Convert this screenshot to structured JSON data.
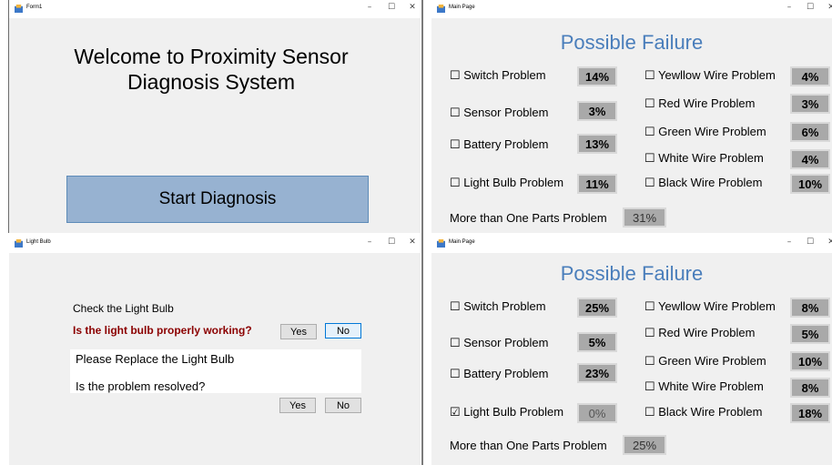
{
  "form1": {
    "title": "Form1",
    "welcome_line1": "Welcome to Proximity Sensor",
    "welcome_line2": "Diagnosis System",
    "start_button": "Start Diagnosis"
  },
  "lightbulb": {
    "title": "Light Bulb",
    "check_label": "Check the Light Bulb",
    "question": "Is the light bulb properly working?",
    "yes": "Yes",
    "no": "No",
    "replace_text": "Please Replace the Light Bulb",
    "resolved_text": "Is the problem resolved?",
    "yes2": "Yes",
    "no2": "No"
  },
  "window_controls": {
    "minimize": "–",
    "maximize": "☐",
    "close": "✕"
  },
  "main1": {
    "title": "Main Page",
    "heading": "Possible Failure",
    "items": [
      {
        "label": "☐ Switch Problem",
        "value": "14%"
      },
      {
        "label": "☐ Sensor Problem",
        "value": "3%"
      },
      {
        "label": "☐ Battery Problem",
        "value": "13%"
      },
      {
        "label": "☐ Light Bulb Problem",
        "value": "11%"
      },
      {
        "label": "☐ Yewllow Wire Problem",
        "value": "4%"
      },
      {
        "label": "☐ Red Wire Problem",
        "value": "3%"
      },
      {
        "label": "☐ Green Wire Problem",
        "value": "6%"
      },
      {
        "label": "☐ White Wire Problem",
        "value": "4%"
      },
      {
        "label": "☐ Black Wire Problem",
        "value": "10%"
      }
    ],
    "multi_label": "More than One Parts Problem",
    "multi_value": "31%"
  },
  "main2": {
    "title": "Main Page",
    "heading": "Possible Failure",
    "items": [
      {
        "label": "☐ Switch Problem",
        "value": "25%"
      },
      {
        "label": "☐ Sensor Problem",
        "value": "5%"
      },
      {
        "label": "☐ Battery Problem",
        "value": "23%"
      },
      {
        "label": "☑ Light Bulb Problem",
        "value": "0%"
      },
      {
        "label": "☐ Yewllow Wire Problem",
        "value": "8%"
      },
      {
        "label": "☐ Red Wire Problem",
        "value": "5%"
      },
      {
        "label": "☐ Green Wire Problem",
        "value": "10%"
      },
      {
        "label": "☐ White Wire Problem",
        "value": "8%"
      },
      {
        "label": "☐ Black Wire Problem",
        "value": "18%"
      }
    ],
    "multi_label": "More than One Parts Problem",
    "multi_value": "25%"
  }
}
